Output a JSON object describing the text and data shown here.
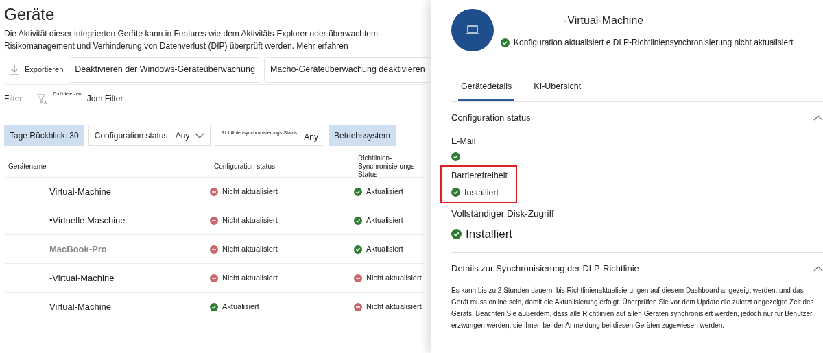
{
  "page": {
    "title": "Geräte",
    "description": "Die Aktivität dieser integrierten Geräte kann in Features wie dem Aktivitäts-Explorer oder überwachtem Risikomanagement und Verhinderung von Datenverlust (DIP) überprüft werden.",
    "learn_more": "Mehr erfahren"
  },
  "toolbar": {
    "export": "Exportieren",
    "buttons": [
      "Deaktivieren der Windows-Geräteüberwachung",
      "Macho-Geräteüberwachung deaktivieren"
    ]
  },
  "filter_bar": {
    "label": "Filter",
    "reset": "Zurücksetzen",
    "filter": "Jom Filter"
  },
  "filters": [
    {
      "kind": "chip",
      "label": "Tage Rückblick: 30"
    },
    {
      "kind": "dropdown",
      "label": "Configuration status:",
      "value": "Any"
    },
    {
      "kind": "tiny",
      "label": "Richtliniensynchronisierungs-Status:",
      "value": "Any"
    },
    {
      "kind": "chip",
      "label": "Betriebssystem"
    }
  ],
  "table": {
    "columns": [
      "Gerätename",
      "Configuration status",
      "Richtlinien-Synchronisierungs-Status"
    ],
    "rows": [
      {
        "name": "Virtual-Machine",
        "muted": false,
        "config": {
          "kind": "error",
          "text": "Nicht aktualisiert"
        },
        "sync": {
          "kind": "ok",
          "text": "Aktualisiert"
        }
      },
      {
        "name": "•Virtuelle Maschine",
        "muted": false,
        "config": {
          "kind": "error",
          "text": "Nicht aktualisiert"
        },
        "sync": {
          "kind": "ok",
          "text": "Aktualisiert"
        }
      },
      {
        "name": "MacBook-Pro",
        "muted": true,
        "config": {
          "kind": "error",
          "text": "Nicht aktualisiert"
        },
        "sync": {
          "kind": "ok",
          "text": "Aktualisiert"
        }
      },
      {
        "name": "-Virtual-Machine",
        "muted": false,
        "config": {
          "kind": "error",
          "text": "Nicht aktualisiert"
        },
        "sync": {
          "kind": "error",
          "text": "Nicht aktualisiert"
        }
      },
      {
        "name": "Virtual-Machine",
        "muted": false,
        "config": {
          "kind": "ok",
          "text": "Aktualisiert"
        },
        "sync": {
          "kind": "error",
          "text": "Nicht aktualisiert"
        }
      }
    ]
  },
  "panel": {
    "title": "-Virtual-Machine",
    "status": {
      "kind": "ok",
      "text": "Konfiguration aktualisiert e DLP-Richtliniensynchronisierung nicht aktualisiert"
    },
    "tabs": [
      {
        "label": "Gerätedetails",
        "selected": true
      },
      {
        "label": "KI-Übersicht",
        "selected": false
      }
    ],
    "sections": [
      {
        "kind": "status_list",
        "title": "Configuration status",
        "expanded": true,
        "items": [
          {
            "label": "E-Mail",
            "kind": "ok",
            "highlighted": false,
            "large": false
          },
          {
            "label": "Barrierefreiheit",
            "kind": "ok",
            "text": "Installiert",
            "highlighted": true,
            "large": false
          },
          {
            "label": "Vollständiger Disk-Zugriff",
            "kind": "ok",
            "text": "Installiert",
            "highlighted": false,
            "large": true
          }
        ]
      },
      {
        "kind": "text",
        "title": "Details zur Synchronisierung der DLP-Richtlinie",
        "expanded": true,
        "text": "Es kann bis zu 2 Stunden dauern, bis Richtlinienaktualisierungen auf diesem Dashboard angezeigt werden, und das Gerät muss online sein, damit die Aktualisierung erfolgt. Überprüfen Sie vor dem Update die zuletzt angezeigte Zeit des Geräts. Beachten Sie außerdem, dass alle Richtlinien auf allen Geräten synchronisiert werden, jedoch nur für Benutzer erzwungen werden, die ihnen bei der Anmeldung bei diesen Geräten zugewiesen werden."
      }
    ]
  }
}
